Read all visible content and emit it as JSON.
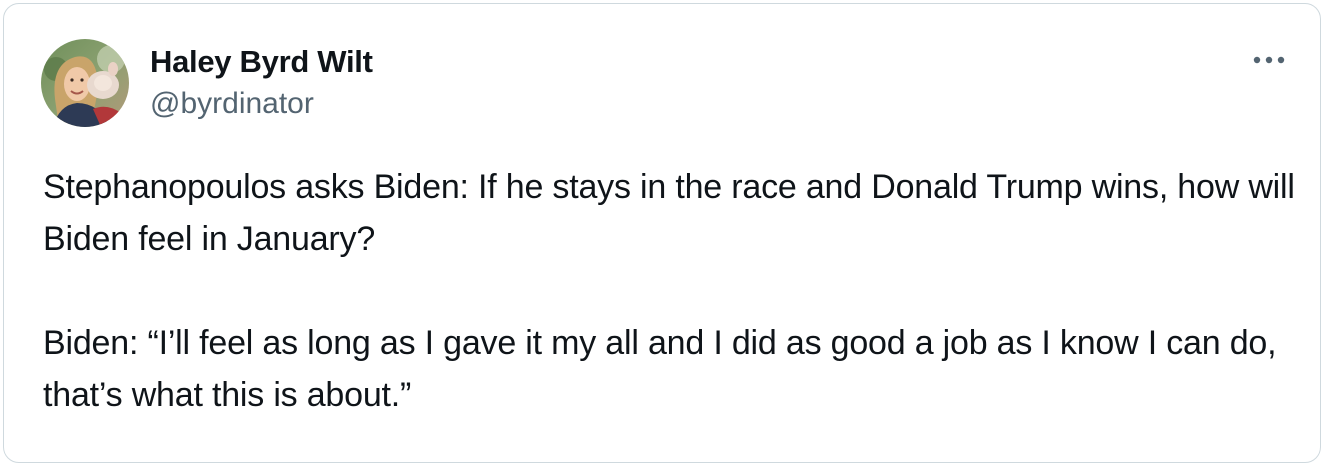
{
  "tweet": {
    "author": {
      "name": "Haley Byrd Wilt",
      "handle": "@byrdinator"
    },
    "paragraphs": [
      "Stephanopoulos asks Biden: If he stays in the race and Donald Trump wins, how will Biden feel in January?",
      "Biden: “I’ll feel as long as I gave it my all and I did as good a job as I know I can do, that’s what this is about.”"
    ]
  },
  "icons": {
    "more": "more-horizontal-icon",
    "avatar": "profile-photo"
  },
  "colors": {
    "text": "#0f1419",
    "secondary_text": "#536471",
    "border": "#cfd9de",
    "background": "#ffffff"
  }
}
